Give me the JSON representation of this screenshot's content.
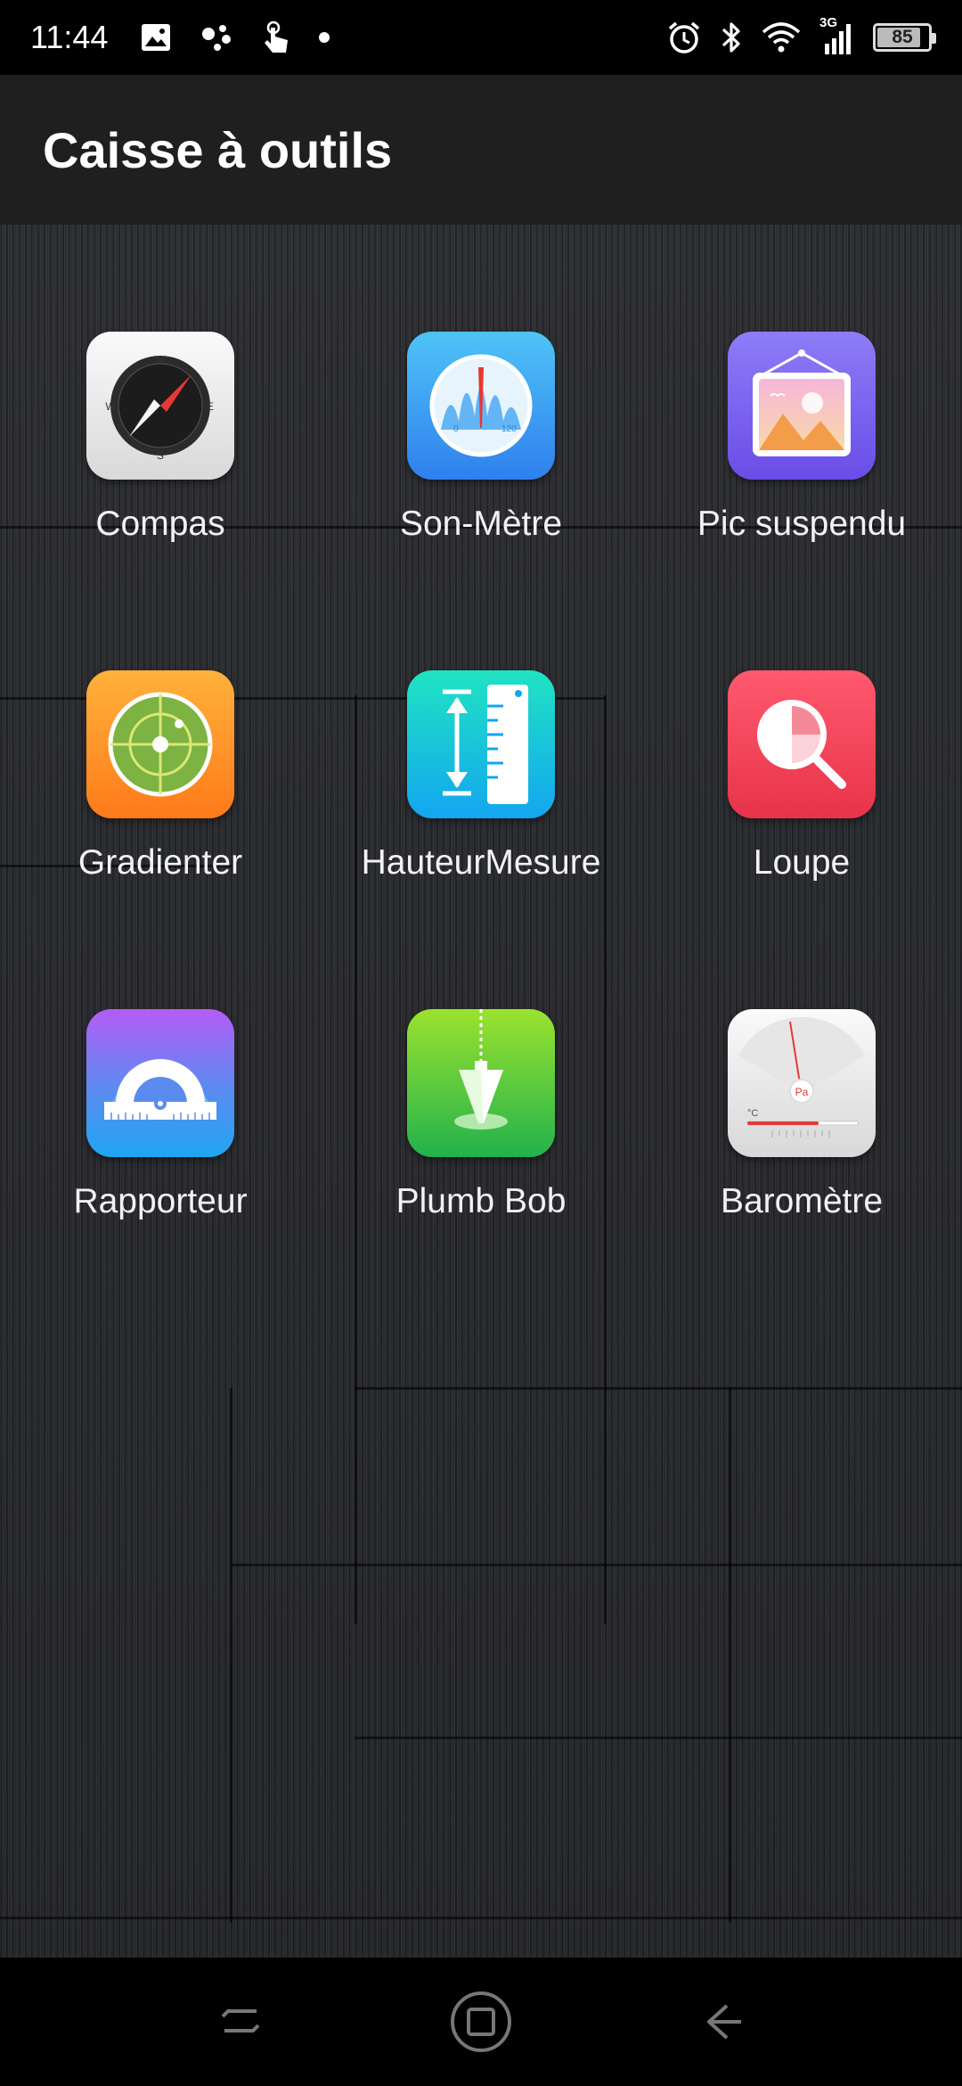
{
  "status_bar": {
    "time": "11:44",
    "left_icons": [
      "image-icon",
      "assistant-dots-icon",
      "touch-icon",
      "dot-icon"
    ],
    "right_icons": [
      "alarm-icon",
      "bluetooth-icon",
      "wifi-icon",
      "cellular-icon"
    ],
    "network_type": "3G",
    "battery_percent": "85",
    "battery_level": 0.85
  },
  "app_bar": {
    "title": "Caisse à outils"
  },
  "tools": [
    {
      "label": "Compas",
      "icon": "compass-icon"
    },
    {
      "label": "Son-Mètre",
      "icon": "sound-meter-icon"
    },
    {
      "label": "Pic suspendu",
      "icon": "hanging-picture-icon"
    },
    {
      "label": "Gradienter",
      "icon": "level-icon"
    },
    {
      "label": "HauteurMesure",
      "icon": "height-measure-icon"
    },
    {
      "label": "Loupe",
      "icon": "magnifier-icon"
    },
    {
      "label": "Rapporteur",
      "icon": "protractor-icon"
    },
    {
      "label": "Plumb Bob",
      "icon": "plumb-bob-icon"
    },
    {
      "label": "Baromètre",
      "icon": "barometer-icon"
    }
  ],
  "nav_bar": {
    "buttons": [
      "recents-icon",
      "home-icon",
      "back-icon"
    ]
  },
  "colors": {
    "app_bar_bg": "#1f1f1f",
    "content_bg": "#2a2b2f",
    "status_bar_bg": "#000000"
  }
}
